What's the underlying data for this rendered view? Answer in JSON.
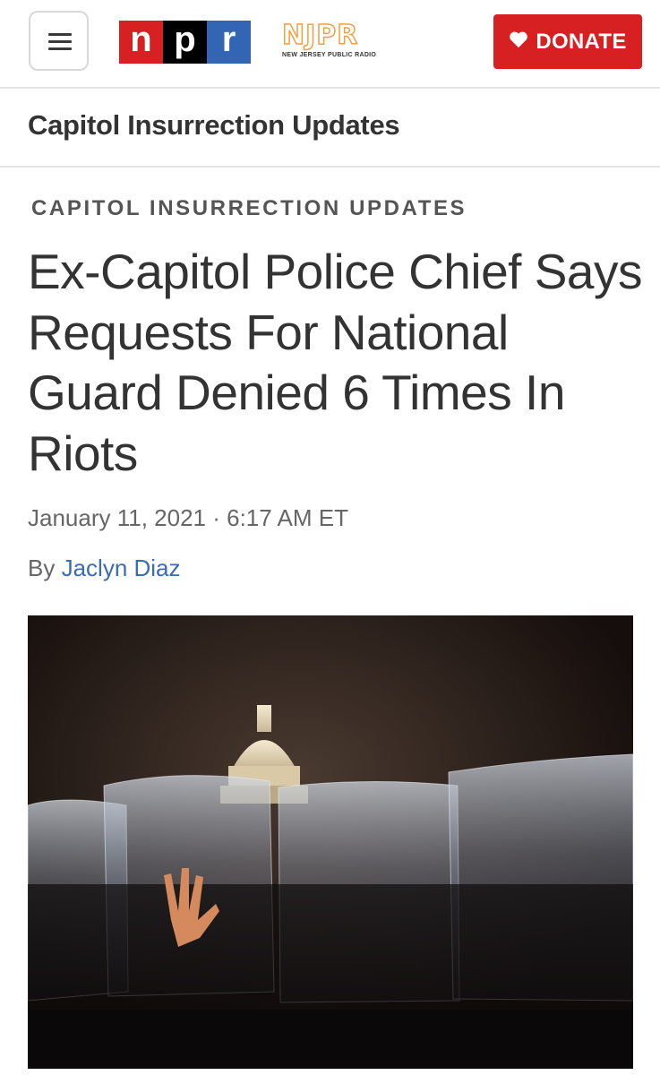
{
  "header": {
    "menu_icon": "hamburger-menu-icon",
    "npr_letters": [
      "n",
      "p",
      "r"
    ],
    "npr_colors": [
      "#d62021",
      "#000000",
      "#3266b5"
    ],
    "station_name": "NJPR",
    "station_subtitle": "NEW JERSEY PUBLIC RADIO",
    "donate_icon": "heart-icon",
    "donate_label": "DONATE",
    "donate_color": "#d62021"
  },
  "section": {
    "title": "Capitol Insurrection Updates"
  },
  "article": {
    "kicker": "CAPITOL INSURRECTION UPDATES",
    "headline": "Ex-Capitol Police Chief Says Requests For National Guard Denied 6 Times In Riots",
    "date": "January 11, 2021 · 6:17 AM ET",
    "byline_prefix": "By",
    "author": "Jaclyn Diaz",
    "author_color": "#3a6bb5"
  }
}
